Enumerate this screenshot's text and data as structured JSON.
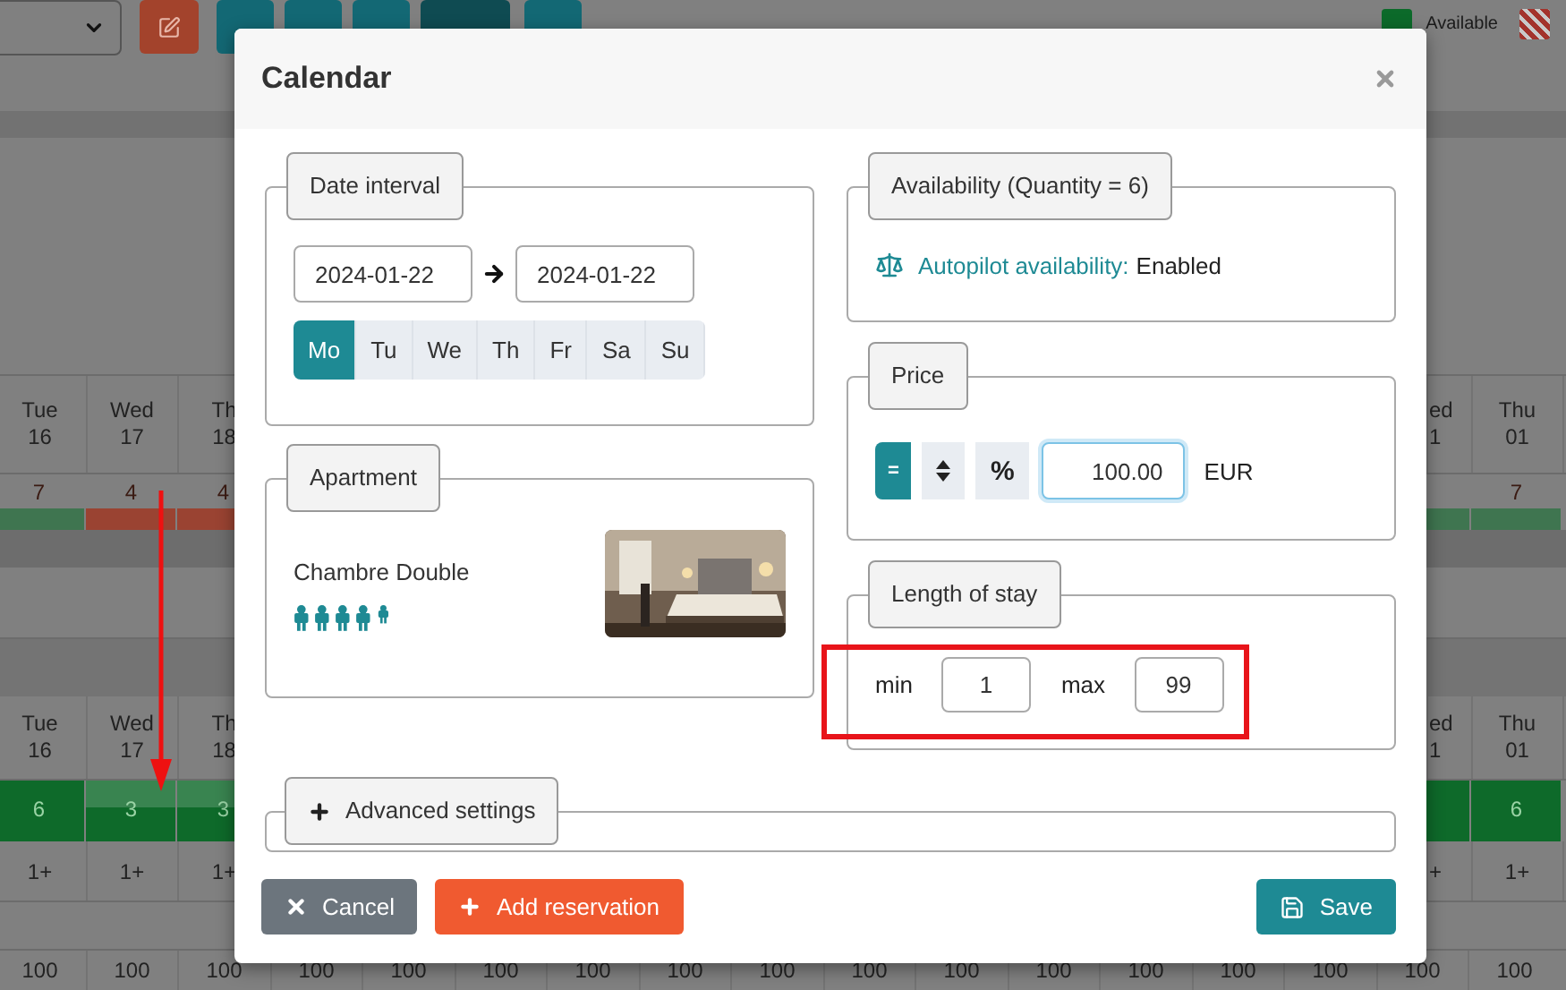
{
  "background": {
    "legend": [
      {
        "kind": "solid",
        "label": "Available",
        "color": "#0c6a2a"
      },
      {
        "kind": "hatched",
        "color": "#a3332c"
      }
    ],
    "sections": [
      {
        "days": {
          "left": [
            {
              "weekday": "Tue",
              "day": "16"
            },
            {
              "weekday": "Wed",
              "day": "17"
            },
            {
              "weekday": "Th",
              "day": "18"
            }
          ],
          "right": [
            {
              "weekday": "ed",
              "day": "1"
            },
            {
              "weekday": "Thu",
              "day": "01"
            }
          ]
        },
        "status": {
          "left": [
            {
              "value": "7",
              "color": "#3f7550",
              "selected": false
            },
            {
              "value": "4",
              "color": "#9a4332",
              "selected": false
            },
            {
              "value": "4",
              "color": "#9a4332",
              "selected": false
            }
          ],
          "right": [
            {
              "color": "#3f7550",
              "selected": false
            },
            {
              "value": "7",
              "color": "#3f7550",
              "selected": false
            }
          ]
        }
      },
      {
        "days": {
          "left": [
            {
              "weekday": "Tue",
              "day": "16"
            },
            {
              "weekday": "Wed",
              "day": "17"
            },
            {
              "weekday": "Th",
              "day": "18"
            }
          ],
          "right": [
            {
              "weekday": "ed",
              "day": "1"
            },
            {
              "weekday": "Thu",
              "day": "01"
            }
          ]
        },
        "status": {
          "left": [
            {
              "value": "6",
              "color": "#0e6a2a",
              "selected": false
            },
            {
              "value": "3",
              "color": "#0e6a2a",
              "selected": true
            },
            {
              "value": "3",
              "color": "#0e6a2a",
              "selected": true
            }
          ],
          "right": [
            {
              "color": "#0e6a2a",
              "selected": false
            },
            {
              "value": "6",
              "color": "#0e6a2a",
              "selected": false
            }
          ]
        }
      }
    ],
    "min_stay": {
      "left": [
        "1+",
        "1+",
        "1+"
      ],
      "right": [
        "+",
        "1+"
      ]
    },
    "prices": [
      "100",
      "100",
      "100",
      "100",
      "100",
      "100",
      "100",
      "100",
      "100",
      "100",
      "100",
      "100",
      "100",
      "100",
      "100",
      "100",
      "100"
    ]
  },
  "modal": {
    "title": "Calendar",
    "date_interval": {
      "legend": "Date interval",
      "from": "2024-01-22",
      "to": "2024-01-22",
      "weekdays": [
        {
          "label": "Mo",
          "selected": true
        },
        {
          "label": "Tu",
          "selected": false
        },
        {
          "label": "We",
          "selected": false
        },
        {
          "label": "Th",
          "selected": false
        },
        {
          "label": "Fr",
          "selected": false
        },
        {
          "label": "Sa",
          "selected": false
        },
        {
          "label": "Su",
          "selected": false
        }
      ]
    },
    "apartment": {
      "legend": "Apartment",
      "name": "Chambre Double"
    },
    "availability": {
      "legend": "Availability (Quantity = 6)",
      "label": "Autopilot availability:",
      "value": "Enabled"
    },
    "price": {
      "legend": "Price",
      "modes": [
        {
          "kind": "text",
          "label": "=",
          "selected": true
        },
        {
          "kind": "icon",
          "selected": false
        },
        {
          "kind": "text",
          "label": "%",
          "selected": false
        }
      ],
      "amount": "100.00",
      "currency": "EUR"
    },
    "length_of_stay": {
      "legend": "Length of stay",
      "min_label": "min",
      "min": "1",
      "max_label": "max",
      "max": "99"
    },
    "advanced": {
      "legend": "Advanced settings",
      "expanded": false
    },
    "buttons": [
      {
        "kind": "cancel",
        "label": "Cancel"
      },
      {
        "kind": "add",
        "label": "Add reservation"
      },
      {
        "kind": "save",
        "label": "Save"
      }
    ]
  }
}
